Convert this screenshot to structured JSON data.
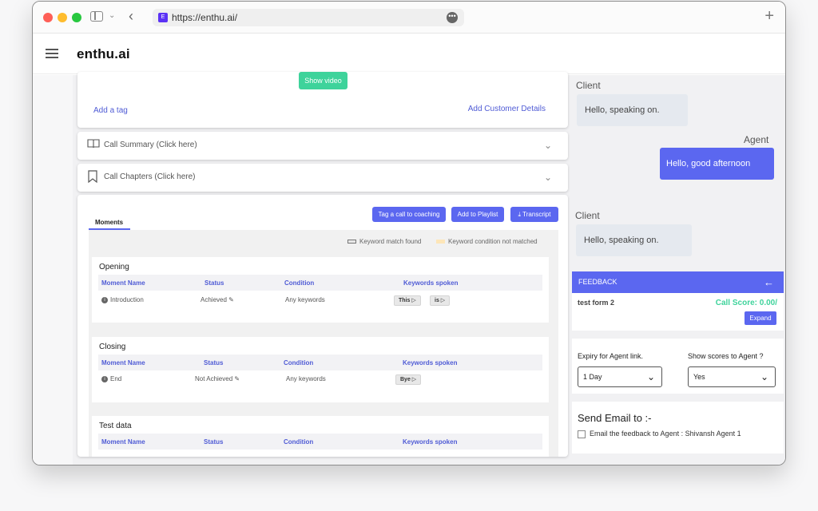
{
  "browser": {
    "url": "https://enthu.ai/",
    "favicon_letter": "E"
  },
  "app": {
    "brand": "enthu.ai"
  },
  "top_card": {
    "show_video": "Show video",
    "add_tag": "Add a tag",
    "add_customer_details": "Add Customer Details"
  },
  "accordions": {
    "summary": "Call Summary (Click here)",
    "chapters": "Call Chapters (Click here)"
  },
  "moments_card": {
    "tab": "Moments",
    "buttons": {
      "coaching": "Tag a call to coaching",
      "playlist": "Add to Playlist",
      "transcript": "Transcript"
    },
    "legend": {
      "found": "Keyword match found",
      "not_matched": "Keyword condition not matched"
    },
    "columns": [
      "Moment Name",
      "Status",
      "Condition",
      "Keywords spoken"
    ],
    "sections": [
      {
        "title": "Opening",
        "row": {
          "name": "Introduction",
          "status": "Achieved",
          "condition": "Any keywords",
          "keywords": [
            "This",
            "is"
          ]
        }
      },
      {
        "title": "Closing",
        "row": {
          "name": "End",
          "status": "Not Achieved",
          "condition": "Any keywords",
          "keywords": [
            "Bye"
          ]
        }
      },
      {
        "title": "Test data"
      }
    ]
  },
  "chat": {
    "client_label": "Client",
    "agent_label": "Agent",
    "client_msg_1": "Hello, speaking on.",
    "agent_msg": "Hello, good afternoon",
    "client_msg_2": "Hello, speaking on."
  },
  "feedback": {
    "title": "FEEDBACK",
    "form_name": "test form 2",
    "call_score": "Call Score: 0.00/",
    "expand": "Expand",
    "expiry_label": "Expiry for Agent link.",
    "expiry_value": "1 Day",
    "scores_label": "Show scores to Agent ?",
    "scores_value": "Yes",
    "send_email_title": "Send Email to :-",
    "email_checkbox": "Email the feedback to Agent : Shivansh Agent 1"
  },
  "colors": {
    "accent": "#5b67f0",
    "green": "#3ed39b"
  }
}
